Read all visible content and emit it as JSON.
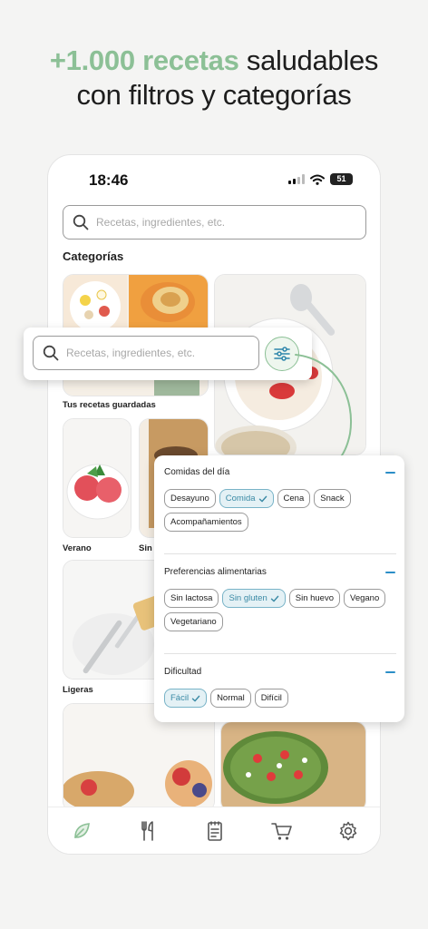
{
  "headline": {
    "accent": "+1.000 recetas",
    "rest": " saludables",
    "line2": "con filtros y categorías"
  },
  "status": {
    "time": "18:46",
    "battery": "51"
  },
  "search": {
    "placeholder": "Recetas, ingredientes, etc."
  },
  "categories": {
    "title": "Categorías",
    "labels": {
      "saved": "Tus recetas guardadas",
      "summer": "Verano",
      "sin": "Sin",
      "light": "Ligeras"
    }
  },
  "filters": {
    "groups": [
      {
        "title": "Comidas del día",
        "chips": [
          {
            "label": "Desayuno",
            "selected": false
          },
          {
            "label": "Comida",
            "selected": true
          },
          {
            "label": "Cena",
            "selected": false
          },
          {
            "label": "Snack",
            "selected": false
          },
          {
            "label": "Acompañamientos",
            "selected": false
          }
        ]
      },
      {
        "title": "Preferencias alimentarias",
        "chips": [
          {
            "label": "Sin lactosa",
            "selected": false
          },
          {
            "label": "Sin gluten",
            "selected": true
          },
          {
            "label": "Sin huevo",
            "selected": false
          },
          {
            "label": "Vegano",
            "selected": false
          },
          {
            "label": "Vegetariano",
            "selected": false
          }
        ]
      },
      {
        "title": "Dificultad",
        "chips": [
          {
            "label": "Fácil",
            "selected": true
          },
          {
            "label": "Normal",
            "selected": false
          },
          {
            "label": "Difícil",
            "selected": false
          }
        ]
      }
    ]
  },
  "tabbar": {
    "items": [
      {
        "icon": "leaf-icon"
      },
      {
        "icon": "cutlery-icon"
      },
      {
        "icon": "notepad-icon"
      },
      {
        "icon": "cart-icon"
      },
      {
        "icon": "gear-icon"
      }
    ]
  },
  "colors": {
    "accent_green": "#8cc096",
    "selected_blue": "#3a8aa5",
    "collapse_blue": "#2b8ec7"
  }
}
